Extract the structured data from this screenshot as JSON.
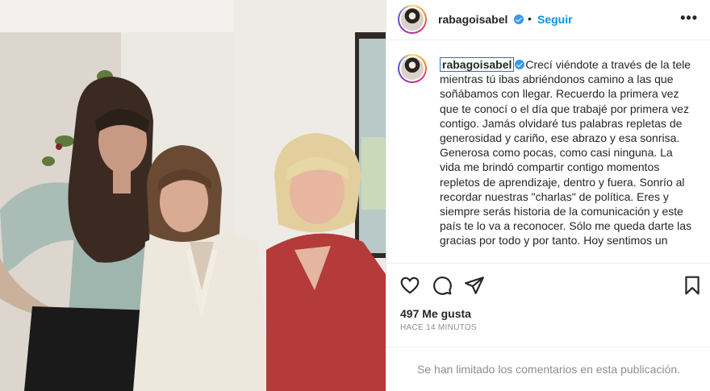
{
  "post": {
    "photo_label": "photo-of-three-women",
    "header": {
      "username": "rabagoisabel",
      "separator": "•",
      "follow_label": "Seguir",
      "more_icon": "more-options-icon",
      "more_glyph": "•••"
    },
    "caption": {
      "username": "rabagoisabel",
      "text": "Crecí viéndote a través de la tele mientras tú ibas abriéndonos camino a las que soñábamos con llegar. Recuerdo la primera vez que te conocí o el día que trabajé por primera vez contigo. Jamás olvidaré tus palabras repletas de generosidad y cariño, ese abrazo y esa sonrisa. Generosa como pocas, como casi ninguna. La vida me brindó compartir contigo momentos repletos de aprendizaje, dentro y fuera. Sonrío al recordar nuestras \"charlas\" de política. Eres y siempre serás historia de la comunicación y este país te lo va a reconocer. Sólo me queda darte las gracias por todo y por tanto. Hoy sentimos un"
    },
    "actions": {
      "like_icon": "heart-icon",
      "comment_icon": "comment-icon",
      "share_icon": "share-icon",
      "save_icon": "bookmark-icon"
    },
    "likes": "497 Me gusta",
    "timestamp": "HACE 14 MINUTOS",
    "comments_notice": "Se han limitado los comentarios en esta publicación.",
    "colors": {
      "accent": "#0095f6",
      "verified": "#3897f0",
      "muted": "#8e8e8e",
      "text": "#262626"
    }
  }
}
